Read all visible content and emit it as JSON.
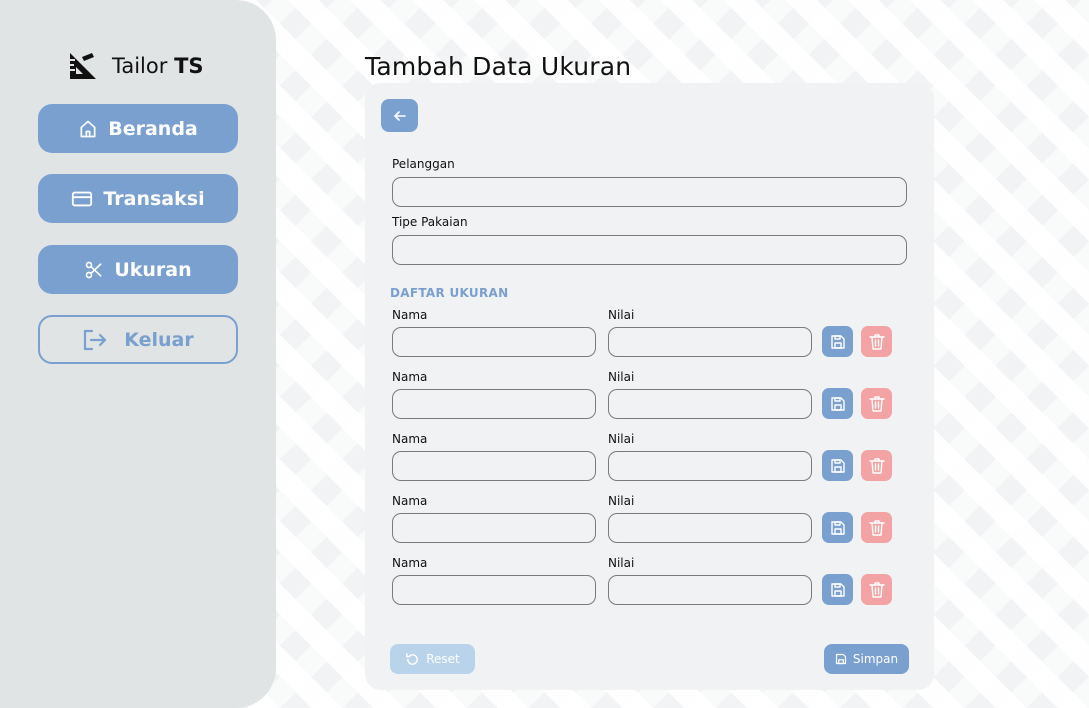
{
  "brand": {
    "name": "Tailor",
    "name_bold": "TS",
    "icon": "ruler-triangle-icon"
  },
  "nav": {
    "beranda": {
      "label": "Beranda",
      "icon": "home-icon"
    },
    "transaksi": {
      "label": "Transaksi",
      "icon": "credit-card-icon"
    },
    "ukuran": {
      "label": "Ukuran",
      "icon": "scissors-icon"
    },
    "keluar": {
      "label": "Keluar",
      "icon": "logout-icon"
    }
  },
  "page": {
    "title": "Tambah Data Ukuran"
  },
  "form": {
    "back_icon": "arrow-left-icon",
    "pelanggan": {
      "label": "Pelanggan",
      "value": ""
    },
    "tipe_pakaian": {
      "label": "Tipe Pakaian",
      "value": ""
    },
    "section_title": "DAFTAR UKURAN",
    "rows": [
      {
        "name_label": "Nama",
        "value_label": "Nilai",
        "name": "",
        "value": ""
      },
      {
        "name_label": "Nama",
        "value_label": "Nilai",
        "name": "",
        "value": ""
      },
      {
        "name_label": "Nama",
        "value_label": "Nilai",
        "name": "",
        "value": ""
      },
      {
        "name_label": "Nama",
        "value_label": "Nilai",
        "name": "",
        "value": ""
      },
      {
        "name_label": "Nama",
        "value_label": "Nilai",
        "name": "",
        "value": ""
      }
    ],
    "reset_label": "Reset",
    "save_label": "Simpan"
  },
  "colors": {
    "accent": "#7aa0d0",
    "danger": "#f3a3a3",
    "reset": "#b9d4ea",
    "sidebar": "#e1e4e5"
  }
}
